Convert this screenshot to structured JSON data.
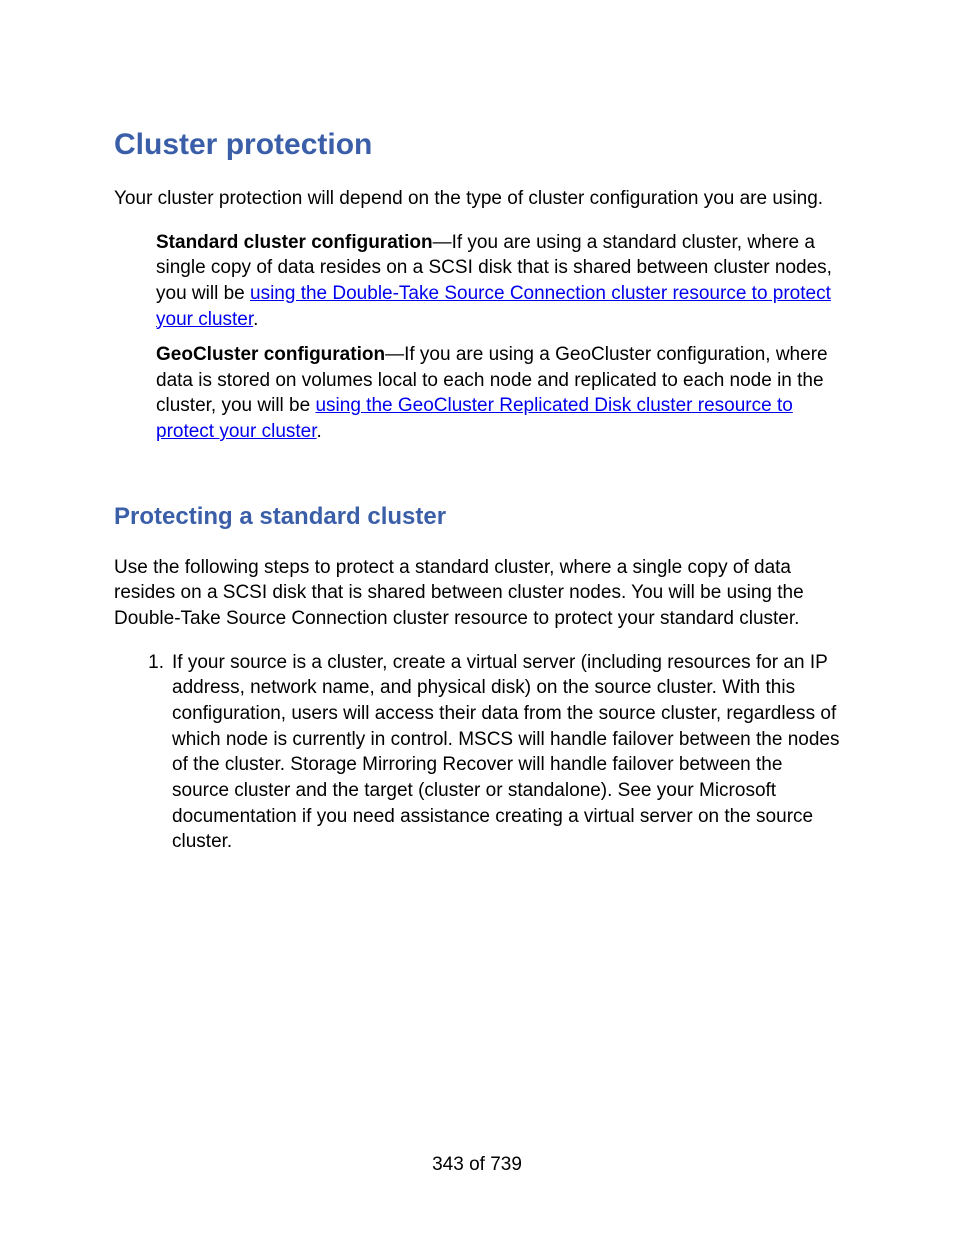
{
  "headings": {
    "h1": "Cluster protection",
    "h2": "Protecting a standard cluster"
  },
  "intro": "Your cluster protection will depend on the type of cluster configuration you are using.",
  "configs": {
    "standard": {
      "label": "Standard cluster configuration",
      "dash": "—",
      "text_before_link": "If you are using a standard cluster, where a single copy of data resides on a SCSI disk that is shared between cluster nodes, you will be ",
      "link": "using the Double-Take Source Connection cluster resource to protect your cluster",
      "text_after_link": "."
    },
    "geo": {
      "label": "GeoCluster configuration",
      "dash": "—",
      "text_before_link": "If you are using a GeoCluster configuration, where data is stored on volumes local to each node and replicated to each node in the cluster, you will be ",
      "link": "using the GeoCluster Replicated Disk cluster resource to protect your cluster",
      "text_after_link": "."
    }
  },
  "protecting_intro": "Use the following steps to protect a standard cluster, where a single copy of data resides on a SCSI disk that is shared between cluster nodes. You will be using the Double-Take Source Connection cluster resource to protect your standard cluster.",
  "steps": {
    "1": {
      "num": "1.",
      "text": "If your source is a cluster, create a virtual server (including resources for an IP address, network name, and physical disk) on the source cluster. With this configuration, users will access their data from the source cluster, regardless of which node is currently in control. MSCS will handle failover between the nodes of the cluster. Storage Mirroring Recover will handle failover between the source cluster and the target (cluster or standalone). See your Microsoft documentation if you need assistance creating a virtual server on the source cluster."
    }
  },
  "footer": {
    "page_label": "343 of 739"
  }
}
